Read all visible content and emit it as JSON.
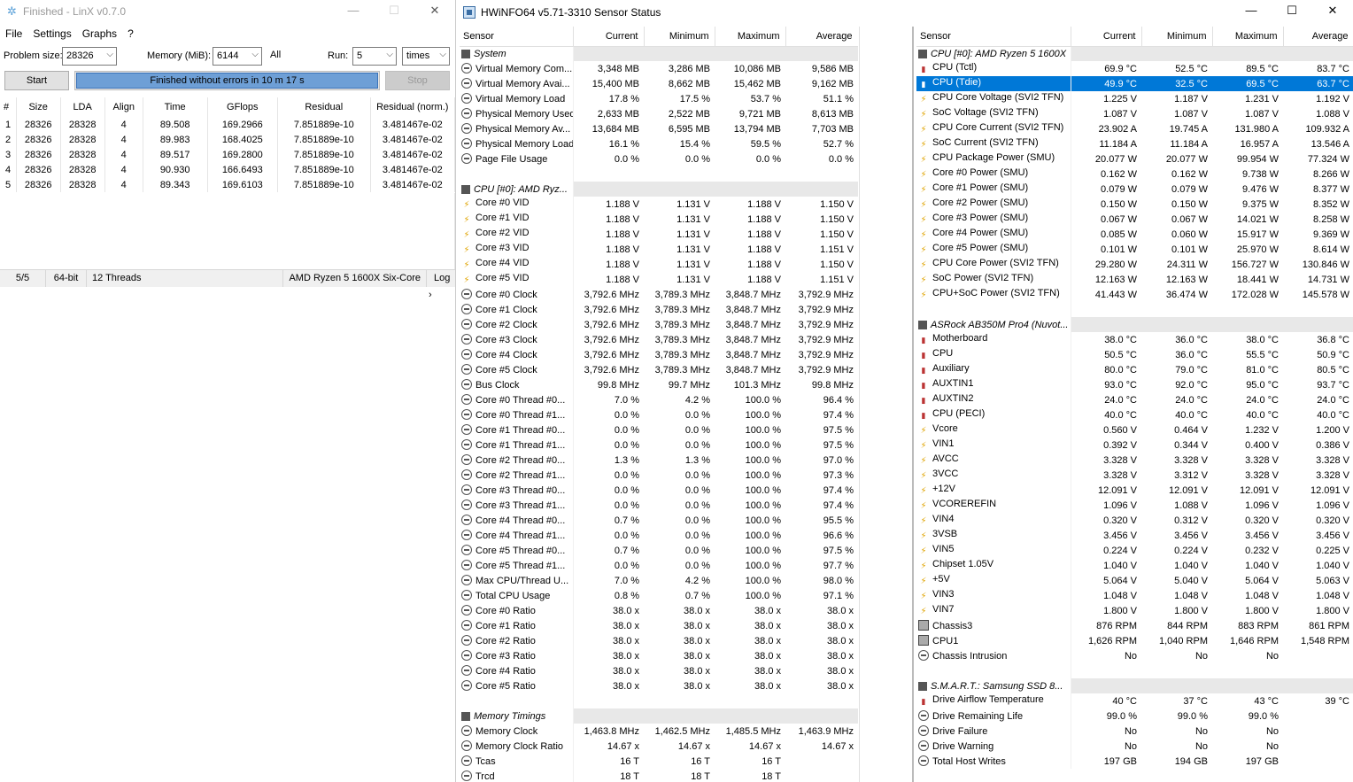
{
  "linx": {
    "title": "Finished - LinX v0.7.0",
    "menu": [
      "File",
      "Settings",
      "Graphs",
      "?"
    ],
    "problem_size_label": "Problem size:",
    "problem_size": "28326",
    "memory_label": "Memory (MiB):",
    "memory": "6144",
    "all_label": "All",
    "run_label": "Run:",
    "run": "5",
    "run_unit": "times",
    "start_label": "Start",
    "stop_label": "Stop",
    "progress_text": "Finished without errors in 10 m 17 s",
    "progress_fraction": 1.0,
    "columns": [
      "#",
      "Size",
      "LDA",
      "Align",
      "Time",
      "GFlops",
      "Residual",
      "Residual (norm.)"
    ],
    "rows": [
      [
        "1",
        "28326",
        "28328",
        "4",
        "89.508",
        "169.2966",
        "7.851889e-10",
        "3.481467e-02"
      ],
      [
        "2",
        "28326",
        "28328",
        "4",
        "89.983",
        "168.4025",
        "7.851889e-10",
        "3.481467e-02"
      ],
      [
        "3",
        "28326",
        "28328",
        "4",
        "89.517",
        "169.2800",
        "7.851889e-10",
        "3.481467e-02"
      ],
      [
        "4",
        "28326",
        "28328",
        "4",
        "90.930",
        "166.6493",
        "7.851889e-10",
        "3.481467e-02"
      ],
      [
        "5",
        "28326",
        "28328",
        "4",
        "89.343",
        "169.6103",
        "7.851889e-10",
        "3.481467e-02"
      ]
    ],
    "status": {
      "runs": "5/5",
      "bits": "64-bit",
      "threads": "12 Threads",
      "cpu": "AMD Ryzen 5 1600X Six-Core",
      "log": "Log"
    }
  },
  "hwinfo": {
    "title": "HWiNFO64 v5.71-3310 Sensor Status",
    "columns": [
      "Sensor",
      "Current",
      "Minimum",
      "Maximum",
      "Average"
    ],
    "left": [
      {
        "g": "System"
      },
      {
        "i": "clk",
        "n": "Virtual Memory Com...",
        "v": [
          "3,348 MB",
          "3,286 MB",
          "10,086 MB",
          "9,586 MB"
        ]
      },
      {
        "i": "clk",
        "n": "Virtual Memory Avai...",
        "v": [
          "15,400 MB",
          "8,662 MB",
          "15,462 MB",
          "9,162 MB"
        ]
      },
      {
        "i": "clk",
        "n": "Virtual Memory Load",
        "v": [
          "17.8 %",
          "17.5 %",
          "53.7 %",
          "51.1 %"
        ]
      },
      {
        "i": "clk",
        "n": "Physical Memory Used",
        "v": [
          "2,633 MB",
          "2,522 MB",
          "9,721 MB",
          "8,613 MB"
        ]
      },
      {
        "i": "clk",
        "n": "Physical Memory Av...",
        "v": [
          "13,684 MB",
          "6,595 MB",
          "13,794 MB",
          "7,703 MB"
        ]
      },
      {
        "i": "clk",
        "n": "Physical Memory Load",
        "v": [
          "16.1 %",
          "15.4 %",
          "59.5 %",
          "52.7 %"
        ]
      },
      {
        "i": "clk",
        "n": "Page File Usage",
        "v": [
          "0.0 %",
          "0.0 %",
          "0.0 %",
          "0.0 %"
        ]
      },
      {
        "b": 1
      },
      {
        "g": "CPU [#0]: AMD Ryz..."
      },
      {
        "i": "bolt",
        "n": "Core #0 VID",
        "v": [
          "1.188 V",
          "1.131 V",
          "1.188 V",
          "1.150 V"
        ]
      },
      {
        "i": "bolt",
        "n": "Core #1 VID",
        "v": [
          "1.188 V",
          "1.131 V",
          "1.188 V",
          "1.150 V"
        ]
      },
      {
        "i": "bolt",
        "n": "Core #2 VID",
        "v": [
          "1.188 V",
          "1.131 V",
          "1.188 V",
          "1.150 V"
        ]
      },
      {
        "i": "bolt",
        "n": "Core #3 VID",
        "v": [
          "1.188 V",
          "1.131 V",
          "1.188 V",
          "1.151 V"
        ]
      },
      {
        "i": "bolt",
        "n": "Core #4 VID",
        "v": [
          "1.188 V",
          "1.131 V",
          "1.188 V",
          "1.150 V"
        ]
      },
      {
        "i": "bolt",
        "n": "Core #5 VID",
        "v": [
          "1.188 V",
          "1.131 V",
          "1.188 V",
          "1.151 V"
        ]
      },
      {
        "i": "clk",
        "n": "Core #0 Clock",
        "v": [
          "3,792.6 MHz",
          "3,789.3 MHz",
          "3,848.7 MHz",
          "3,792.9 MHz"
        ]
      },
      {
        "i": "clk",
        "n": "Core #1 Clock",
        "v": [
          "3,792.6 MHz",
          "3,789.3 MHz",
          "3,848.7 MHz",
          "3,792.9 MHz"
        ]
      },
      {
        "i": "clk",
        "n": "Core #2 Clock",
        "v": [
          "3,792.6 MHz",
          "3,789.3 MHz",
          "3,848.7 MHz",
          "3,792.9 MHz"
        ]
      },
      {
        "i": "clk",
        "n": "Core #3 Clock",
        "v": [
          "3,792.6 MHz",
          "3,789.3 MHz",
          "3,848.7 MHz",
          "3,792.9 MHz"
        ]
      },
      {
        "i": "clk",
        "n": "Core #4 Clock",
        "v": [
          "3,792.6 MHz",
          "3,789.3 MHz",
          "3,848.7 MHz",
          "3,792.9 MHz"
        ]
      },
      {
        "i": "clk",
        "n": "Core #5 Clock",
        "v": [
          "3,792.6 MHz",
          "3,789.3 MHz",
          "3,848.7 MHz",
          "3,792.9 MHz"
        ]
      },
      {
        "i": "clk",
        "n": "Bus Clock",
        "v": [
          "99.8 MHz",
          "99.7 MHz",
          "101.3 MHz",
          "99.8 MHz"
        ]
      },
      {
        "i": "clk",
        "n": "Core #0 Thread #0...",
        "v": [
          "7.0 %",
          "4.2 %",
          "100.0 %",
          "96.4 %"
        ]
      },
      {
        "i": "clk",
        "n": "Core #0 Thread #1...",
        "v": [
          "0.0 %",
          "0.0 %",
          "100.0 %",
          "97.4 %"
        ]
      },
      {
        "i": "clk",
        "n": "Core #1 Thread #0...",
        "v": [
          "0.0 %",
          "0.0 %",
          "100.0 %",
          "97.5 %"
        ]
      },
      {
        "i": "clk",
        "n": "Core #1 Thread #1...",
        "v": [
          "0.0 %",
          "0.0 %",
          "100.0 %",
          "97.5 %"
        ]
      },
      {
        "i": "clk",
        "n": "Core #2 Thread #0...",
        "v": [
          "1.3 %",
          "1.3 %",
          "100.0 %",
          "97.0 %"
        ]
      },
      {
        "i": "clk",
        "n": "Core #2 Thread #1...",
        "v": [
          "0.0 %",
          "0.0 %",
          "100.0 %",
          "97.3 %"
        ]
      },
      {
        "i": "clk",
        "n": "Core #3 Thread #0...",
        "v": [
          "0.0 %",
          "0.0 %",
          "100.0 %",
          "97.4 %"
        ]
      },
      {
        "i": "clk",
        "n": "Core #3 Thread #1...",
        "v": [
          "0.0 %",
          "0.0 %",
          "100.0 %",
          "97.4 %"
        ]
      },
      {
        "i": "clk",
        "n": "Core #4 Thread #0...",
        "v": [
          "0.7 %",
          "0.0 %",
          "100.0 %",
          "95.5 %"
        ]
      },
      {
        "i": "clk",
        "n": "Core #4 Thread #1...",
        "v": [
          "0.0 %",
          "0.0 %",
          "100.0 %",
          "96.6 %"
        ]
      },
      {
        "i": "clk",
        "n": "Core #5 Thread #0...",
        "v": [
          "0.7 %",
          "0.0 %",
          "100.0 %",
          "97.5 %"
        ]
      },
      {
        "i": "clk",
        "n": "Core #5 Thread #1...",
        "v": [
          "0.0 %",
          "0.0 %",
          "100.0 %",
          "97.7 %"
        ]
      },
      {
        "i": "clk",
        "n": "Max CPU/Thread U...",
        "v": [
          "7.0 %",
          "4.2 %",
          "100.0 %",
          "98.0 %"
        ]
      },
      {
        "i": "clk",
        "n": "Total CPU Usage",
        "v": [
          "0.8 %",
          "0.7 %",
          "100.0 %",
          "97.1 %"
        ]
      },
      {
        "i": "clk",
        "n": "Core #0 Ratio",
        "v": [
          "38.0 x",
          "38.0 x",
          "38.0 x",
          "38.0 x"
        ]
      },
      {
        "i": "clk",
        "n": "Core #1 Ratio",
        "v": [
          "38.0 x",
          "38.0 x",
          "38.0 x",
          "38.0 x"
        ]
      },
      {
        "i": "clk",
        "n": "Core #2 Ratio",
        "v": [
          "38.0 x",
          "38.0 x",
          "38.0 x",
          "38.0 x"
        ]
      },
      {
        "i": "clk",
        "n": "Core #3 Ratio",
        "v": [
          "38.0 x",
          "38.0 x",
          "38.0 x",
          "38.0 x"
        ]
      },
      {
        "i": "clk",
        "n": "Core #4 Ratio",
        "v": [
          "38.0 x",
          "38.0 x",
          "38.0 x",
          "38.0 x"
        ]
      },
      {
        "i": "clk",
        "n": "Core #5 Ratio",
        "v": [
          "38.0 x",
          "38.0 x",
          "38.0 x",
          "38.0 x"
        ]
      },
      {
        "b": 1
      },
      {
        "g": "Memory Timings"
      },
      {
        "i": "clk",
        "n": "Memory Clock",
        "v": [
          "1,463.8 MHz",
          "1,462.5 MHz",
          "1,485.5 MHz",
          "1,463.9 MHz"
        ]
      },
      {
        "i": "clk",
        "n": "Memory Clock Ratio",
        "v": [
          "14.67 x",
          "14.67 x",
          "14.67 x",
          "14.67 x"
        ]
      },
      {
        "i": "clk",
        "n": "Tcas",
        "v": [
          "16 T",
          "16 T",
          "16 T",
          ""
        ]
      },
      {
        "i": "clk",
        "n": "Trcd",
        "v": [
          "18 T",
          "18 T",
          "18 T",
          ""
        ]
      }
    ],
    "right": [
      {
        "g": "CPU [#0]: AMD Ryzen 5 1600X"
      },
      {
        "i": "therm",
        "n": "CPU (Tctl)",
        "v": [
          "69.9 °C",
          "52.5 °C",
          "89.5 °C",
          "83.7 °C"
        ]
      },
      {
        "i": "therm",
        "n": "CPU (Tdie)",
        "v": [
          "49.9 °C",
          "32.5 °C",
          "69.5 °C",
          "63.7 °C"
        ],
        "sel": 1
      },
      {
        "i": "bolt",
        "n": "CPU Core Voltage (SVI2 TFN)",
        "v": [
          "1.225 V",
          "1.187 V",
          "1.231 V",
          "1.192 V"
        ]
      },
      {
        "i": "bolt",
        "n": "SoC Voltage (SVI2 TFN)",
        "v": [
          "1.087 V",
          "1.087 V",
          "1.087 V",
          "1.088 V"
        ]
      },
      {
        "i": "bolt",
        "n": "CPU Core Current (SVI2 TFN)",
        "v": [
          "23.902 A",
          "19.745 A",
          "131.980 A",
          "109.932 A"
        ]
      },
      {
        "i": "bolt",
        "n": "SoC Current (SVI2 TFN)",
        "v": [
          "11.184 A",
          "11.184 A",
          "16.957 A",
          "13.546 A"
        ]
      },
      {
        "i": "bolt",
        "n": "CPU Package Power (SMU)",
        "v": [
          "20.077 W",
          "20.077 W",
          "99.954 W",
          "77.324 W"
        ]
      },
      {
        "i": "bolt",
        "n": "Core #0 Power (SMU)",
        "v": [
          "0.162 W",
          "0.162 W",
          "9.738 W",
          "8.266 W"
        ]
      },
      {
        "i": "bolt",
        "n": "Core #1 Power (SMU)",
        "v": [
          "0.079 W",
          "0.079 W",
          "9.476 W",
          "8.377 W"
        ]
      },
      {
        "i": "bolt",
        "n": "Core #2 Power (SMU)",
        "v": [
          "0.150 W",
          "0.150 W",
          "9.375 W",
          "8.352 W"
        ]
      },
      {
        "i": "bolt",
        "n": "Core #3 Power (SMU)",
        "v": [
          "0.067 W",
          "0.067 W",
          "14.021 W",
          "8.258 W"
        ]
      },
      {
        "i": "bolt",
        "n": "Core #4 Power (SMU)",
        "v": [
          "0.085 W",
          "0.060 W",
          "15.917 W",
          "9.369 W"
        ]
      },
      {
        "i": "bolt",
        "n": "Core #5 Power (SMU)",
        "v": [
          "0.101 W",
          "0.101 W",
          "25.970 W",
          "8.614 W"
        ]
      },
      {
        "i": "bolt",
        "n": "CPU Core Power (SVI2 TFN)",
        "v": [
          "29.280 W",
          "24.311 W",
          "156.727 W",
          "130.846 W"
        ]
      },
      {
        "i": "bolt",
        "n": "SoC Power (SVI2 TFN)",
        "v": [
          "12.163 W",
          "12.163 W",
          "18.441 W",
          "14.731 W"
        ]
      },
      {
        "i": "bolt",
        "n": "CPU+SoC Power (SVI2 TFN)",
        "v": [
          "41.443 W",
          "36.474 W",
          "172.028 W",
          "145.578 W"
        ]
      },
      {
        "b": 1
      },
      {
        "g": "ASRock AB350M Pro4 (Nuvot..."
      },
      {
        "i": "therm",
        "n": "Motherboard",
        "v": [
          "38.0 °C",
          "36.0 °C",
          "38.0 °C",
          "36.8 °C"
        ]
      },
      {
        "i": "therm",
        "n": "CPU",
        "v": [
          "50.5 °C",
          "36.0 °C",
          "55.5 °C",
          "50.9 °C"
        ]
      },
      {
        "i": "therm",
        "n": "Auxiliary",
        "v": [
          "80.0 °C",
          "79.0 °C",
          "81.0 °C",
          "80.5 °C"
        ]
      },
      {
        "i": "therm",
        "n": "AUXTIN1",
        "v": [
          "93.0 °C",
          "92.0 °C",
          "95.0 °C",
          "93.7 °C"
        ]
      },
      {
        "i": "therm",
        "n": "AUXTIN2",
        "v": [
          "24.0 °C",
          "24.0 °C",
          "24.0 °C",
          "24.0 °C"
        ]
      },
      {
        "i": "therm",
        "n": "CPU (PECI)",
        "v": [
          "40.0 °C",
          "40.0 °C",
          "40.0 °C",
          "40.0 °C"
        ]
      },
      {
        "i": "bolt",
        "n": "Vcore",
        "v": [
          "0.560 V",
          "0.464 V",
          "1.232 V",
          "1.200 V"
        ]
      },
      {
        "i": "bolt",
        "n": "VIN1",
        "v": [
          "0.392 V",
          "0.344 V",
          "0.400 V",
          "0.386 V"
        ]
      },
      {
        "i": "bolt",
        "n": "AVCC",
        "v": [
          "3.328 V",
          "3.328 V",
          "3.328 V",
          "3.328 V"
        ]
      },
      {
        "i": "bolt",
        "n": "3VCC",
        "v": [
          "3.328 V",
          "3.312 V",
          "3.328 V",
          "3.328 V"
        ]
      },
      {
        "i": "bolt",
        "n": "+12V",
        "v": [
          "12.091 V",
          "12.091 V",
          "12.091 V",
          "12.091 V"
        ]
      },
      {
        "i": "bolt",
        "n": "VCOREREFIN",
        "v": [
          "1.096 V",
          "1.088 V",
          "1.096 V",
          "1.096 V"
        ]
      },
      {
        "i": "bolt",
        "n": "VIN4",
        "v": [
          "0.320 V",
          "0.312 V",
          "0.320 V",
          "0.320 V"
        ]
      },
      {
        "i": "bolt",
        "n": "3VSB",
        "v": [
          "3.456 V",
          "3.456 V",
          "3.456 V",
          "3.456 V"
        ]
      },
      {
        "i": "bolt",
        "n": "VIN5",
        "v": [
          "0.224 V",
          "0.224 V",
          "0.232 V",
          "0.225 V"
        ]
      },
      {
        "i": "bolt",
        "n": "Chipset 1.05V",
        "v": [
          "1.040 V",
          "1.040 V",
          "1.040 V",
          "1.040 V"
        ]
      },
      {
        "i": "bolt",
        "n": "+5V",
        "v": [
          "5.064 V",
          "5.040 V",
          "5.064 V",
          "5.063 V"
        ]
      },
      {
        "i": "bolt",
        "n": "VIN3",
        "v": [
          "1.048 V",
          "1.048 V",
          "1.048 V",
          "1.048 V"
        ]
      },
      {
        "i": "bolt",
        "n": "VIN7",
        "v": [
          "1.800 V",
          "1.800 V",
          "1.800 V",
          "1.800 V"
        ]
      },
      {
        "i": "fan",
        "n": "Chassis3",
        "v": [
          "876 RPM",
          "844 RPM",
          "883 RPM",
          "861 RPM"
        ]
      },
      {
        "i": "fan",
        "n": "CPU1",
        "v": [
          "1,626 RPM",
          "1,040 RPM",
          "1,646 RPM",
          "1,548 RPM"
        ]
      },
      {
        "i": "clk",
        "n": "Chassis Intrusion",
        "v": [
          "No",
          "No",
          "No",
          ""
        ]
      },
      {
        "b": 1
      },
      {
        "g": "S.M.A.R.T.: Samsung SSD 8..."
      },
      {
        "i": "therm",
        "n": "Drive Airflow Temperature",
        "v": [
          "40 °C",
          "37 °C",
          "43 °C",
          "39 °C"
        ]
      },
      {
        "i": "clk",
        "n": "Drive Remaining Life",
        "v": [
          "99.0 %",
          "99.0 %",
          "99.0 %",
          ""
        ]
      },
      {
        "i": "clk",
        "n": "Drive Failure",
        "v": [
          "No",
          "No",
          "No",
          ""
        ]
      },
      {
        "i": "clk",
        "n": "Drive Warning",
        "v": [
          "No",
          "No",
          "No",
          ""
        ]
      },
      {
        "i": "clk",
        "n": "Total Host Writes",
        "v": [
          "197 GB",
          "194 GB",
          "197 GB",
          ""
        ]
      }
    ]
  }
}
